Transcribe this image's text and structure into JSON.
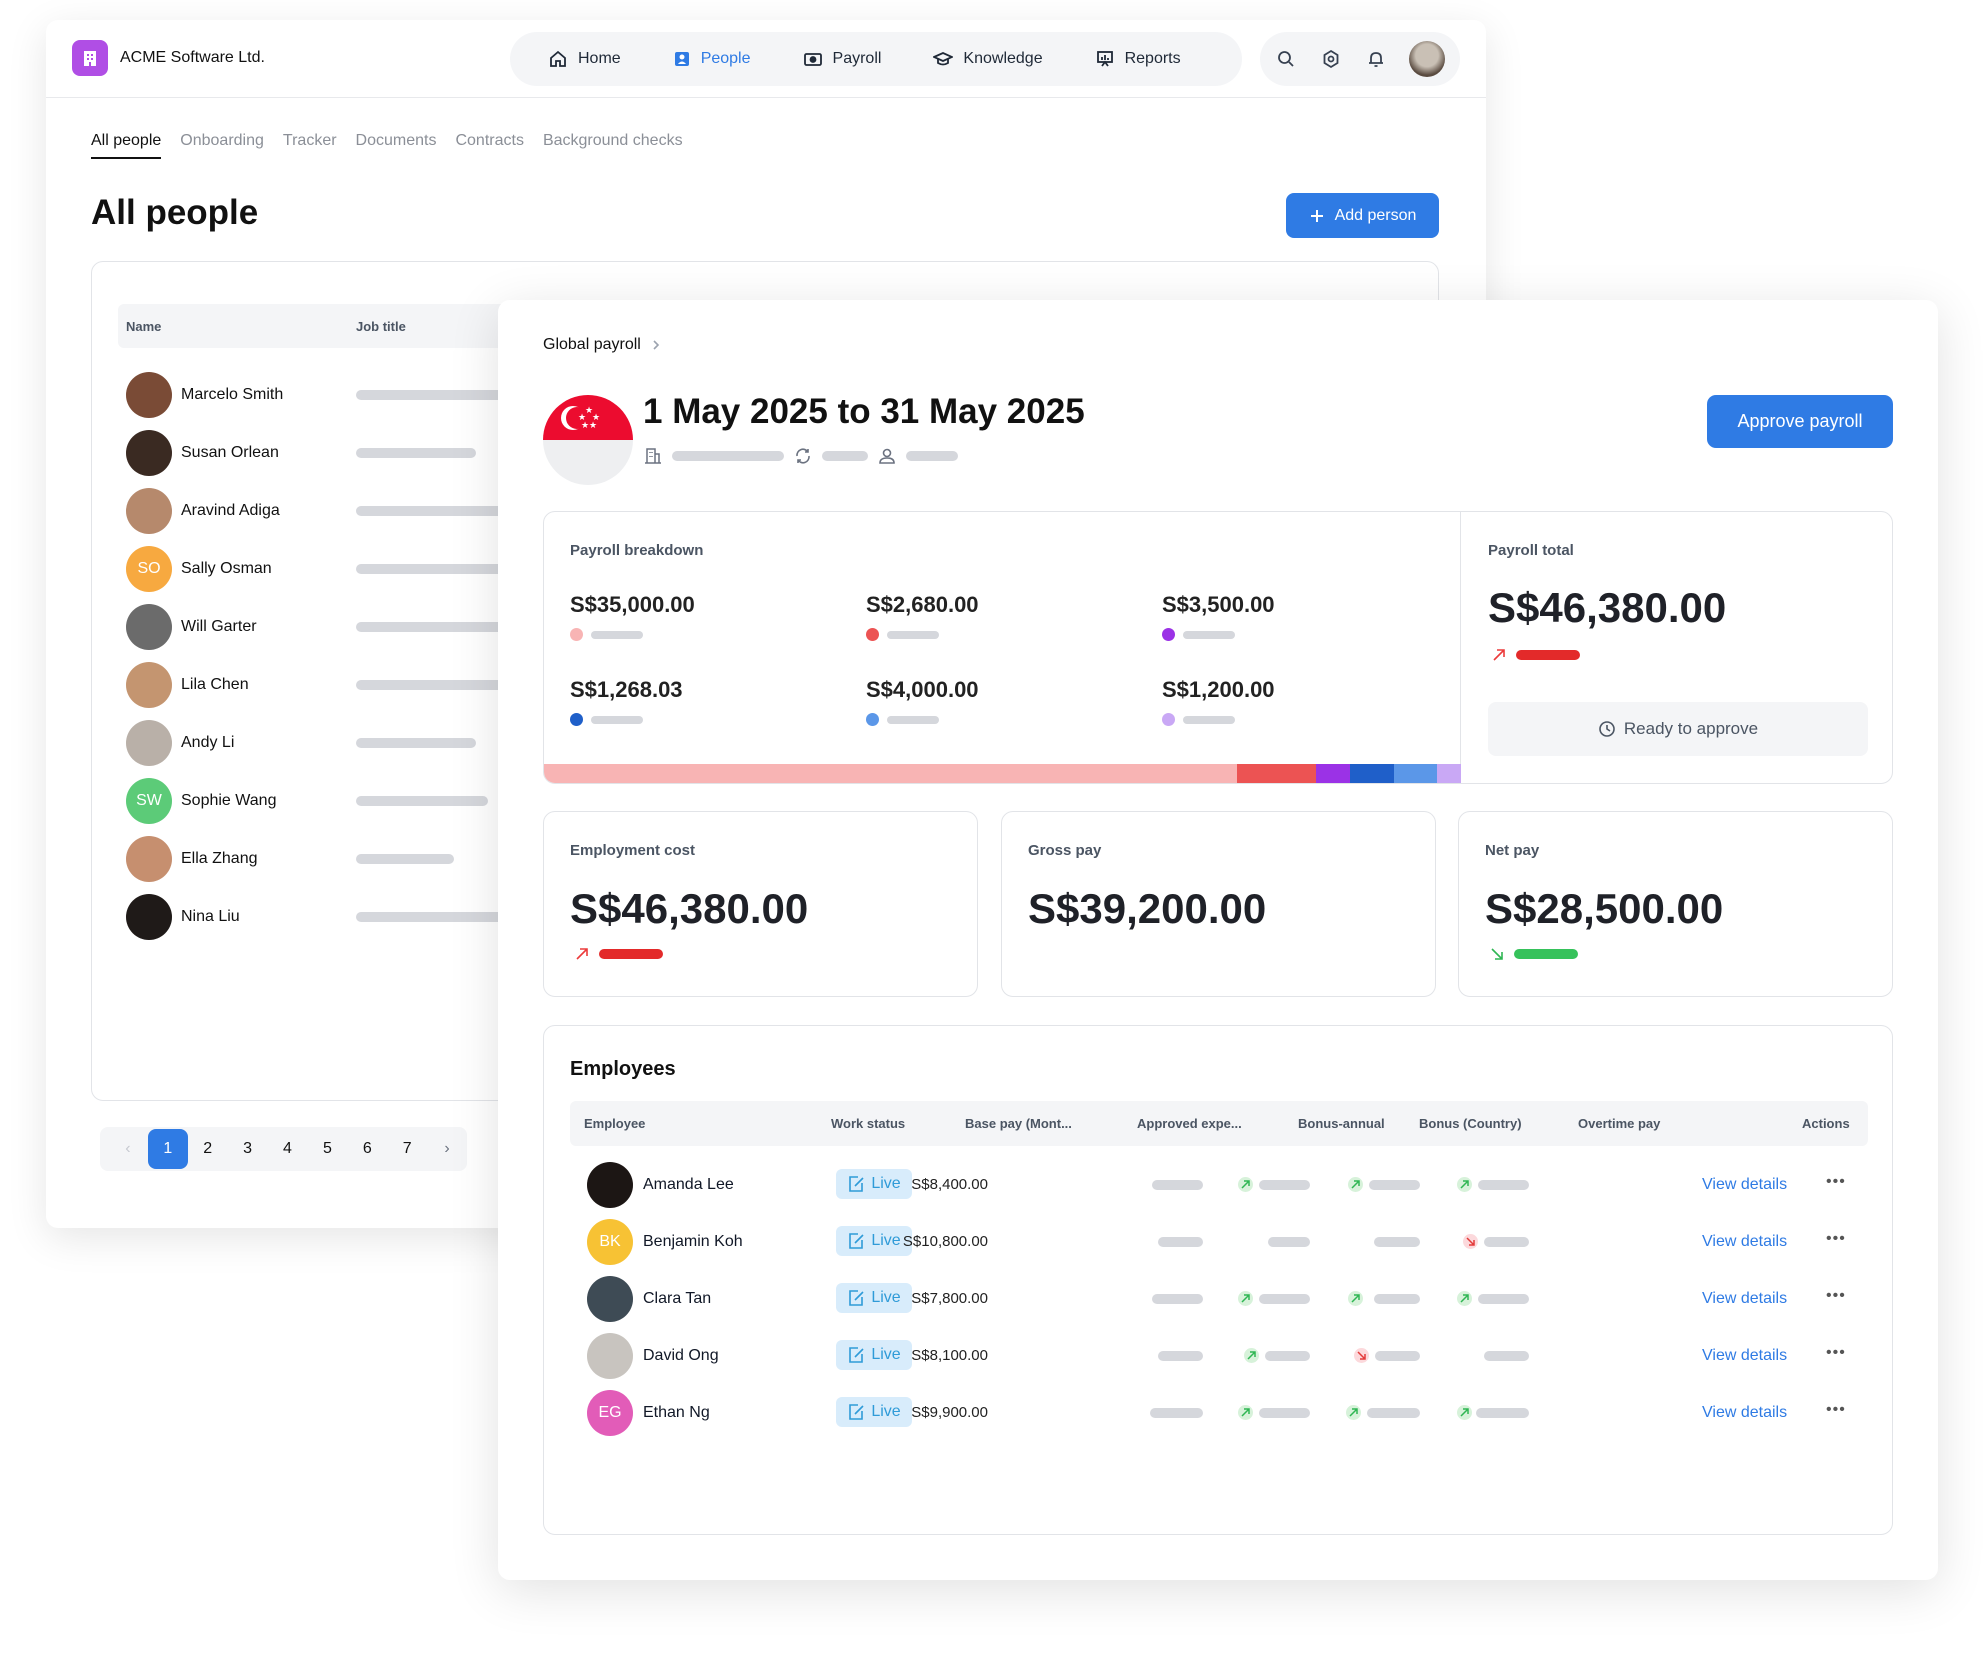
{
  "people_window": {
    "company": "ACME Software Ltd.",
    "nav": [
      {
        "label": "Home",
        "icon": "home-icon"
      },
      {
        "label": "People",
        "icon": "people-icon",
        "active": true
      },
      {
        "label": "Payroll",
        "icon": "payroll-icon"
      },
      {
        "label": "Knowledge",
        "icon": "graduation-cap-icon"
      },
      {
        "label": "Reports",
        "icon": "reports-icon"
      }
    ],
    "tools": [
      "search-icon",
      "gear-icon",
      "bell-icon",
      "user-avatar"
    ],
    "subtabs": [
      "All people",
      "Onboarding",
      "Tracker",
      "Documents",
      "Contracts",
      "Background checks"
    ],
    "title": "All people",
    "add_person": "Add person",
    "columns": {
      "name": "Name",
      "job_title": "Job title"
    },
    "people": [
      {
        "name": "Marcelo Smith",
        "initials": "",
        "color": "#7a4b36"
      },
      {
        "name": "Susan Orlean",
        "initials": "",
        "color": "#3a2a22"
      },
      {
        "name": "Aravind Adiga",
        "initials": "",
        "color": "#b6896c"
      },
      {
        "name": "Sally Osman",
        "initials": "SO",
        "color": "#f7a940"
      },
      {
        "name": "Will Garter",
        "initials": "",
        "color": "#6b6b6b"
      },
      {
        "name": "Lila Chen",
        "initials": "",
        "color": "#c49570"
      },
      {
        "name": "Andy Li",
        "initials": "",
        "color": "#b9b0a8"
      },
      {
        "name": "Sophie Wang",
        "initials": "SW",
        "color": "#5ccb78"
      },
      {
        "name": "Ella Zhang",
        "initials": "",
        "color": "#c68f6f"
      },
      {
        "name": "Nina Liu",
        "initials": "",
        "color": "#1f1a18"
      }
    ],
    "pagination": {
      "prev": "‹",
      "pages": [
        "1",
        "2",
        "3",
        "4",
        "5",
        "6",
        "7"
      ],
      "current": "1",
      "next": "›"
    }
  },
  "payroll_window": {
    "breadcrumb": "Global payroll",
    "period_title": "1 May 2025 to 31 May 2025",
    "approve_label": "Approve payroll",
    "breakdown": {
      "label": "Payroll breakdown",
      "items": [
        {
          "value": "S$35,000.00",
          "color": "#f8b4b4"
        },
        {
          "value": "S$2,680.00",
          "color": "#ec5353"
        },
        {
          "value": "S$3,500.00",
          "color": "#9b32e6"
        },
        {
          "value": "S$1,268.03",
          "color": "#1f5fc9"
        },
        {
          "value": "S$4,000.00",
          "color": "#5b97e8"
        },
        {
          "value": "S$1,200.00",
          "color": "#c9a8f5"
        }
      ]
    },
    "total": {
      "label": "Payroll total",
      "value": "S$46,380.00",
      "trend": "up",
      "status": "Ready to approve"
    },
    "stats": [
      {
        "label": "Employment cost",
        "value": "S$46,380.00",
        "trend": "up"
      },
      {
        "label": "Gross pay",
        "value": "S$39,200.00",
        "trend": ""
      },
      {
        "label": "Net pay",
        "value": "S$28,500.00",
        "trend": "down"
      }
    ],
    "employees": {
      "title": "Employees",
      "columns": [
        "Employee",
        "Work status",
        "Base pay (Mont...",
        "Approved expe...",
        "Bonus-annual",
        "Bonus (Country)",
        "Overtime pay",
        "Actions"
      ],
      "rows": [
        {
          "name": "Amanda Lee",
          "initials": "",
          "color": "#1c1614",
          "status": "Live",
          "base": "S$8,400.00",
          "bonus_annual": "up",
          "bonus_country": "up",
          "overtime": "up",
          "action": "View details"
        },
        {
          "name": "Benjamin Koh",
          "initials": "BK",
          "color": "#f7c234",
          "status": "Live",
          "base": "S$10,800.00",
          "bonus_annual": "",
          "bonus_country": "",
          "overtime": "down",
          "action": "View details"
        },
        {
          "name": "Clara Tan",
          "initials": "",
          "color": "#3e4b55",
          "status": "Live",
          "base": "S$7,800.00",
          "bonus_annual": "up",
          "bonus_country": "up",
          "overtime": "up",
          "action": "View details"
        },
        {
          "name": "David Ong",
          "initials": "",
          "color": "#c8c4bf",
          "status": "Live",
          "base": "S$8,100.00",
          "bonus_annual": "up",
          "bonus_country": "down",
          "overtime": "",
          "action": "View details"
        },
        {
          "name": "Ethan Ng",
          "initials": "EG",
          "color": "#e25cb8",
          "status": "Live",
          "base": "S$9,900.00",
          "bonus_annual": "up",
          "bonus_country": "up",
          "overtime": "up",
          "action": "View details"
        }
      ]
    }
  }
}
